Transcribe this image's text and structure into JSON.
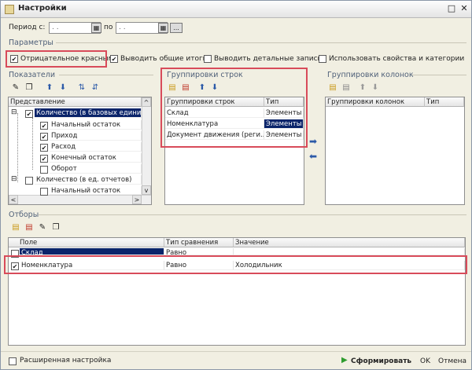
{
  "window": {
    "title": "Настройки",
    "restore_glyph": "□",
    "close_glyph": "✕"
  },
  "period": {
    "from_label": "Период с:",
    "from_value": " .  . ",
    "to_label": "по",
    "to_value": " .  . ",
    "extra_btn": "..."
  },
  "params": {
    "section_title": "Параметры",
    "neg_red": "Отрицательное красным",
    "totals": "Выводить общие итоги",
    "details": "Выводить детальные записи",
    "props": "Использовать свойства и категории"
  },
  "indicators": {
    "section_title": "Показатели",
    "header": "Представление",
    "rows": [
      "Количество (в базовых единиц",
      "Начальный остаток",
      "Приход",
      "Расход",
      "Конечный остаток",
      "Оборот",
      "Количество (в ед. отчетов)",
      "Начальный остаток"
    ]
  },
  "row_groups": {
    "section_title": "Группировки строк",
    "col1": "Группировки строк",
    "col2": "Тип",
    "rows": [
      {
        "name": "Склад",
        "type": "Элементы"
      },
      {
        "name": "Номенклатура",
        "type": "Элементы"
      },
      {
        "name": "Документ движения (реги...",
        "type": "Элементы"
      }
    ]
  },
  "col_groups": {
    "section_title": "Группировки колонок",
    "col1": "Группировки колонок",
    "col2": "Тип"
  },
  "filters": {
    "section_title": "Отборы",
    "col1": "Поле",
    "col2": "Тип сравнения",
    "col3": "Значение",
    "rows": [
      {
        "field": "Склад",
        "cmp": "Равно",
        "value": ""
      },
      {
        "field": "Номенклатура",
        "cmp": "Равно",
        "value": "Холодильник"
      }
    ]
  },
  "footer": {
    "ext_settings": "Расширенная настройка",
    "generate": "Сформировать",
    "ok": "OK",
    "cancel": "Отмена"
  }
}
